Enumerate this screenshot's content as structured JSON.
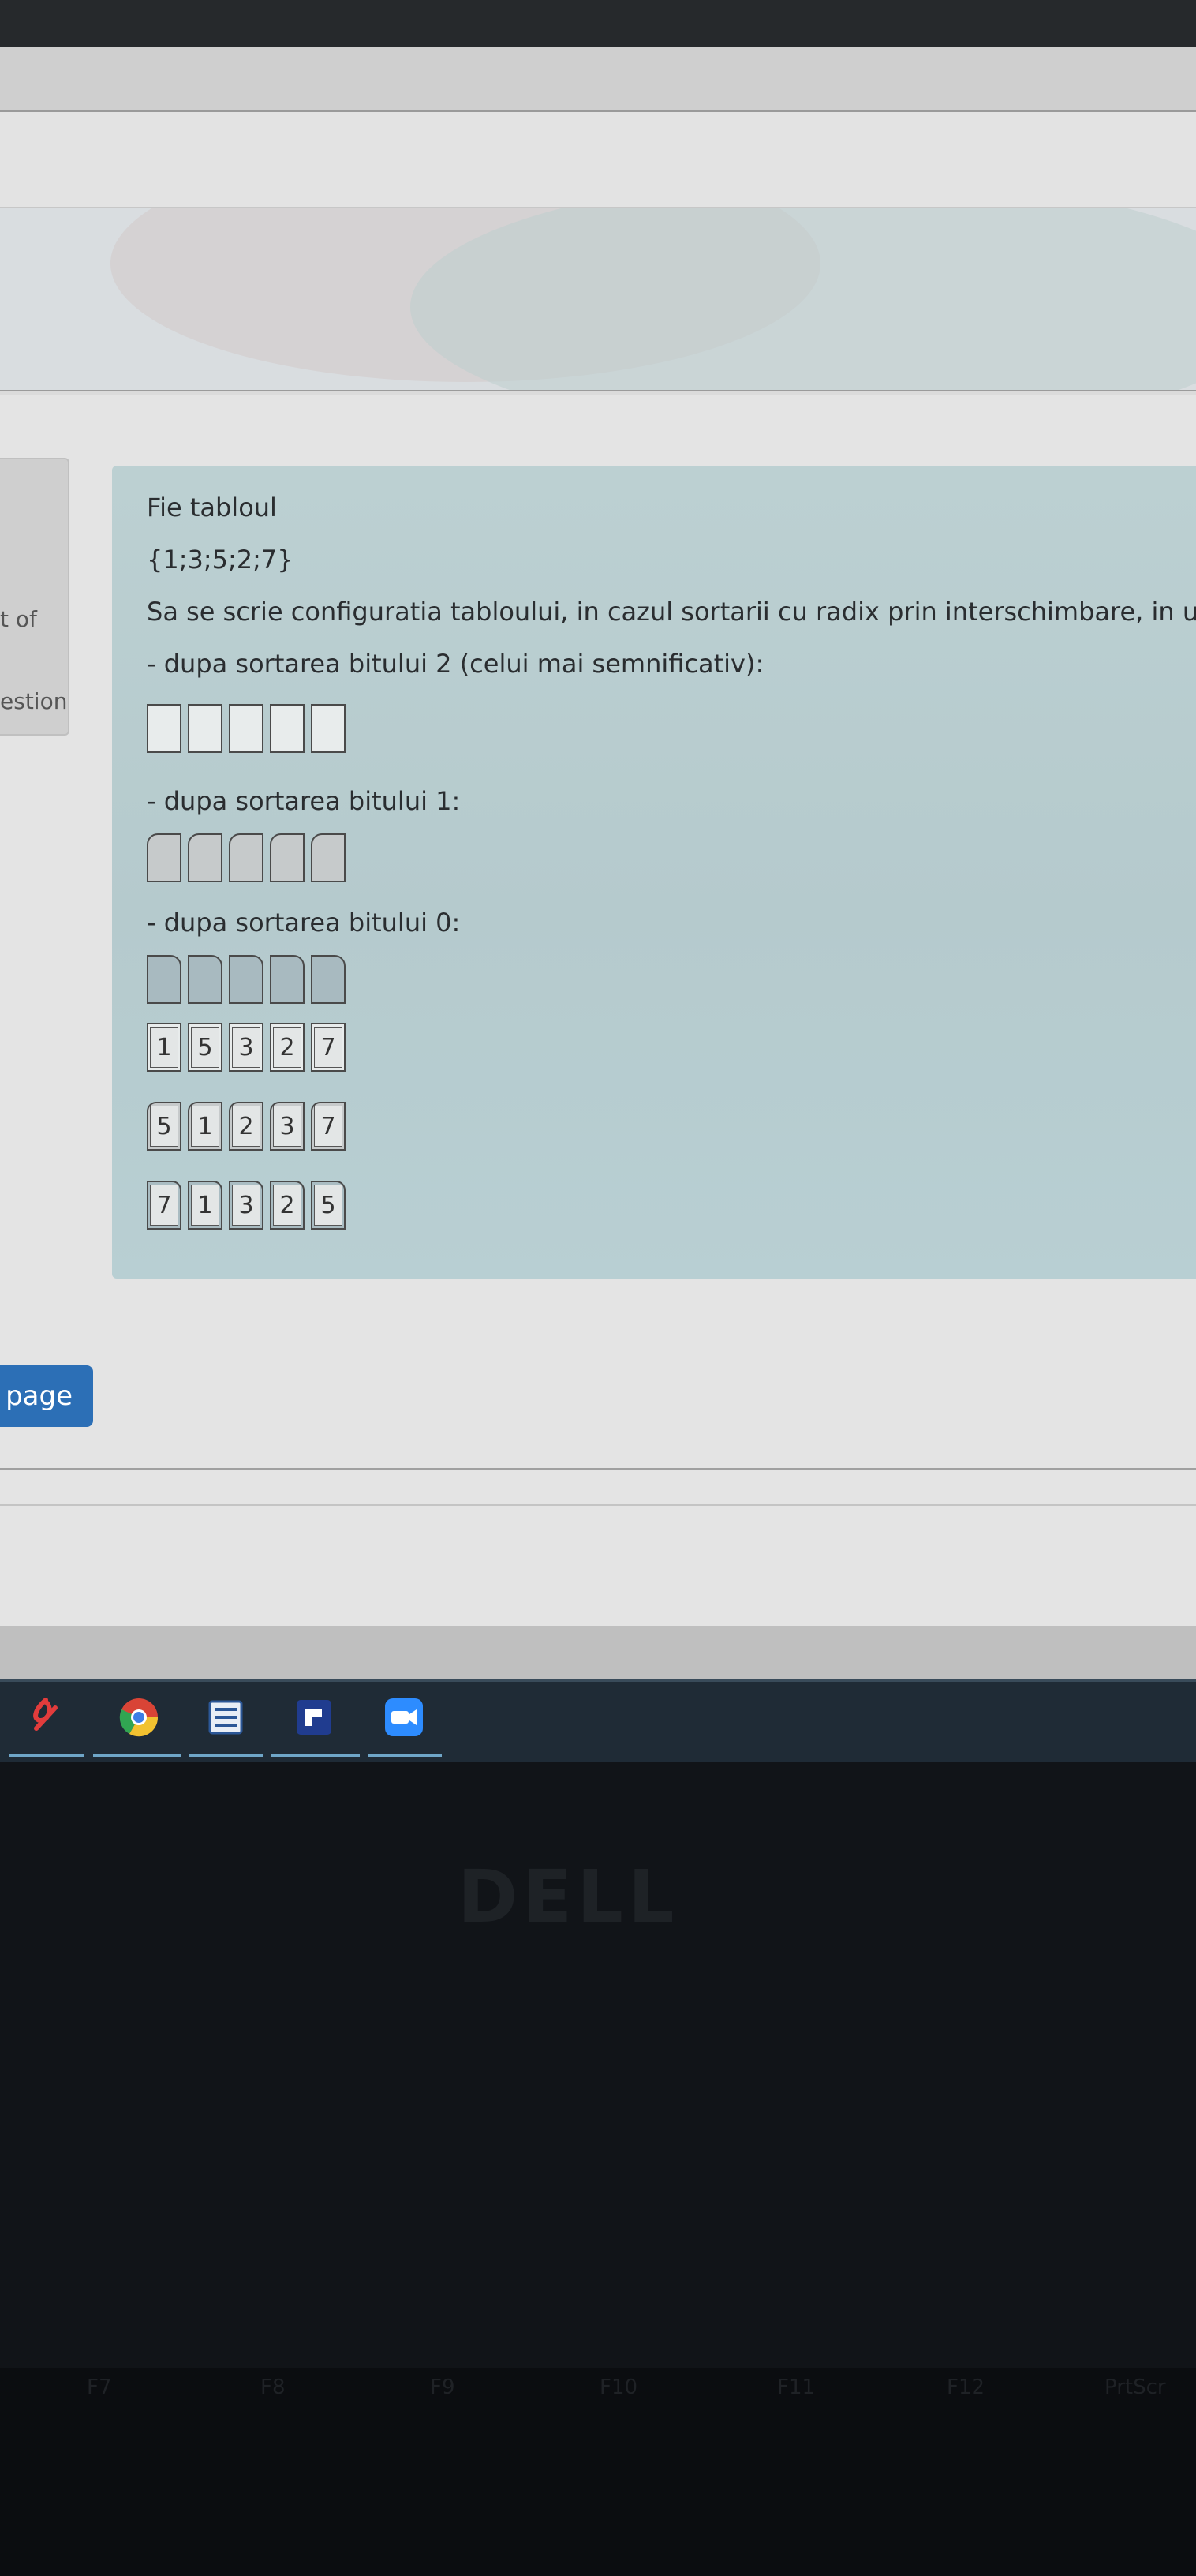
{
  "sidebar": {
    "partial_label_1": "t of",
    "partial_label_2": "estion"
  },
  "question": {
    "line1": "Fie tabloul",
    "array": "{1;3;5;2;7}",
    "prompt": "Sa se scrie configuratia tabloului, in cazul sortarii cu radix prin interschimbare, in urmato",
    "step_bit2": "- dupa sortarea bitului 2 (celui mai semnificativ):",
    "step_bit1": "- dupa sortarea bitului 1:",
    "step_bit0": "- dupa sortarea bitului 0:",
    "answer_rows": [
      [
        "1",
        "5",
        "3",
        "2",
        "7"
      ],
      [
        "5",
        "1",
        "2",
        "3",
        "7"
      ],
      [
        "7",
        "1",
        "3",
        "2",
        "5"
      ]
    ]
  },
  "navigation": {
    "next_page_partial": "page"
  },
  "taskbar": {
    "apps": [
      "pdf-reader-icon",
      "chrome-icon",
      "word-icon",
      "flow-app-icon",
      "zoom-icon"
    ]
  },
  "device": {
    "brand": "DELL",
    "function_keys": [
      "F7",
      "F8",
      "F9",
      "F10",
      "F11",
      "F12",
      "PrtScr"
    ]
  }
}
